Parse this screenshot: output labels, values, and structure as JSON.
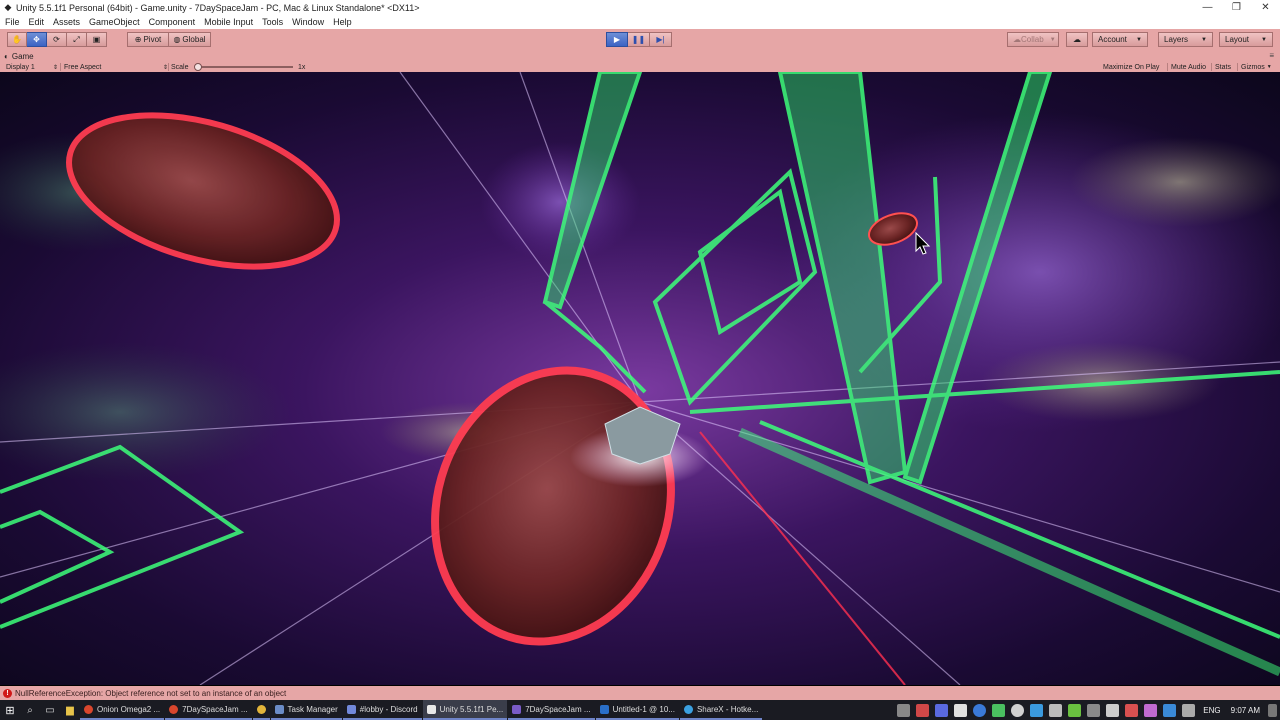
{
  "window": {
    "title": "Unity 5.5.1f1 Personal (64bit) - Game.unity - 7DaySpaceJam - PC, Mac & Linux Standalone* <DX11>",
    "controls": [
      "minimize",
      "restore",
      "close"
    ]
  },
  "menu": [
    "File",
    "Edit",
    "Assets",
    "GameObject",
    "Component",
    "Mobile Input",
    "Tools",
    "Window",
    "Help"
  ],
  "toolbar": {
    "transform_tools": [
      {
        "icon": "hand-icon"
      },
      {
        "icon": "move-icon"
      },
      {
        "icon": "rotate-icon"
      },
      {
        "icon": "scale-icon"
      },
      {
        "icon": "rect-icon"
      }
    ],
    "pivot_label": "Pivot",
    "global_label": "Global",
    "play_controls": [
      {
        "icon": "play-icon",
        "active": true
      },
      {
        "icon": "pause-icon",
        "active": false
      },
      {
        "icon": "step-icon",
        "active": false
      }
    ],
    "collab_label": "Collab",
    "account_label": "Account",
    "layers_label": "Layers",
    "layout_label": "Layout"
  },
  "game_tab": {
    "label": "Game",
    "display": "Display 1",
    "aspect": "Free Aspect",
    "scale_label": "Scale",
    "scale_value": "1x",
    "scale_level": 0.0,
    "buttons": [
      "Maximize On Play",
      "Mute Audio",
      "Stats",
      "Gizmos"
    ]
  },
  "status": {
    "message": "NullReferenceException: Object reference not set to an instance of an object"
  },
  "taskbar": {
    "apps": [
      {
        "label": "Onion Omega2 ...",
        "color": "#d9462d",
        "active": false
      },
      {
        "label": "7DaySpaceJam ...",
        "color": "#d9462d",
        "active": false
      },
      {
        "label": "",
        "color": "#e2b43a",
        "active": false
      },
      {
        "label": "Task Manager",
        "color": "#6b8cc7",
        "active": false
      },
      {
        "label": "#lobby - Discord",
        "color": "#7289da",
        "active": false
      },
      {
        "label": "Unity 5.5.1f1 Pe...",
        "color": "#e8e8e8",
        "active": true
      },
      {
        "label": "7DaySpaceJam ...",
        "color": "#7a5bc7",
        "active": false
      },
      {
        "label": "Untitled-1 @ 10...",
        "color": "#2a6fc9",
        "active": false
      },
      {
        "label": "ShareX - Hotke...",
        "color": "#3ba0e0",
        "active": false
      }
    ],
    "language": "ENG",
    "time": "9:07 AM"
  }
}
